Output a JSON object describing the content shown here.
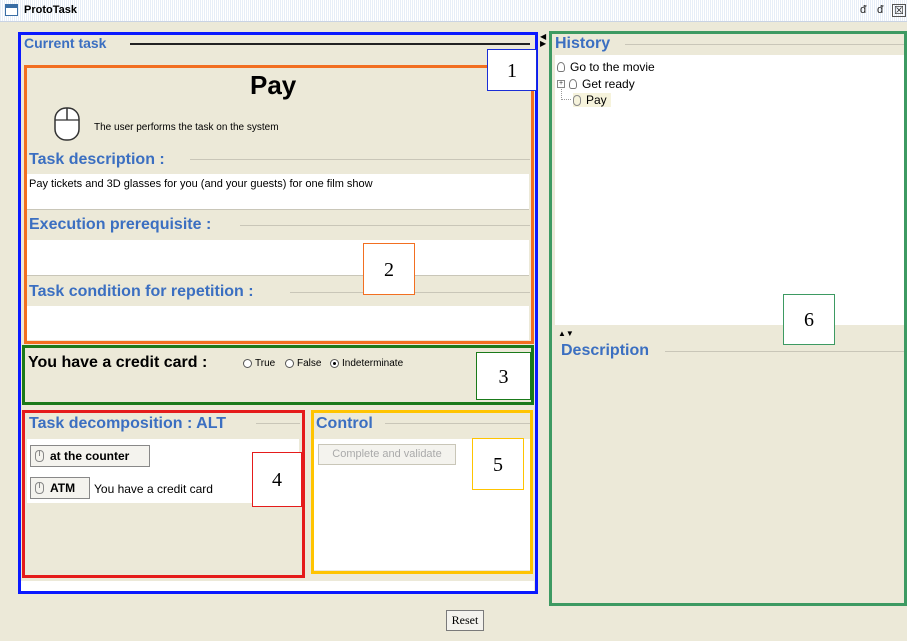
{
  "window": {
    "title": "ProtoTask",
    "controls": {
      "minimize": "ᵭ",
      "maximize": "ᵭ",
      "close": "☒"
    }
  },
  "current_task": {
    "section_title": "Current task",
    "task_name": "Pay",
    "performer_text": "The user performs the task on the system",
    "description_label": "Task description :",
    "description_text": "Pay tickets and 3D glasses for you (and your guests) for one film show",
    "prerequisite_label": "Execution prerequisite :",
    "prerequisite_text": "",
    "repetition_label": "Task condition for repetition :",
    "repetition_text": ""
  },
  "condition": {
    "label": "You have a credit card :",
    "options": [
      "True",
      "False",
      "Indeterminate"
    ],
    "selected": "Indeterminate"
  },
  "decomposition": {
    "title": "Task decomposition : ALT",
    "subtasks": [
      {
        "label": "at the counter",
        "condition": ""
      },
      {
        "label": "ATM",
        "condition": "You have a credit card"
      }
    ]
  },
  "control": {
    "title": "Control",
    "validate_button": "Complete and validate"
  },
  "history": {
    "title": "History",
    "tree": [
      {
        "label": "Go to the movie",
        "level": 0
      },
      {
        "label": "Get ready",
        "level": 1
      },
      {
        "label": "Pay",
        "level": 1
      }
    ],
    "description_title": "Description"
  },
  "footer": {
    "reset_button": "Reset"
  },
  "annotations": [
    "1",
    "2",
    "3",
    "4",
    "5",
    "6"
  ],
  "colors": {
    "frame_1": "#0a19ff",
    "frame_2": "#f26f21",
    "frame_3": "#1a7a1a",
    "frame_4": "#e51b1b",
    "frame_5": "#ffc400",
    "frame_6": "#3d9a62",
    "heading": "#3b6fc1"
  }
}
